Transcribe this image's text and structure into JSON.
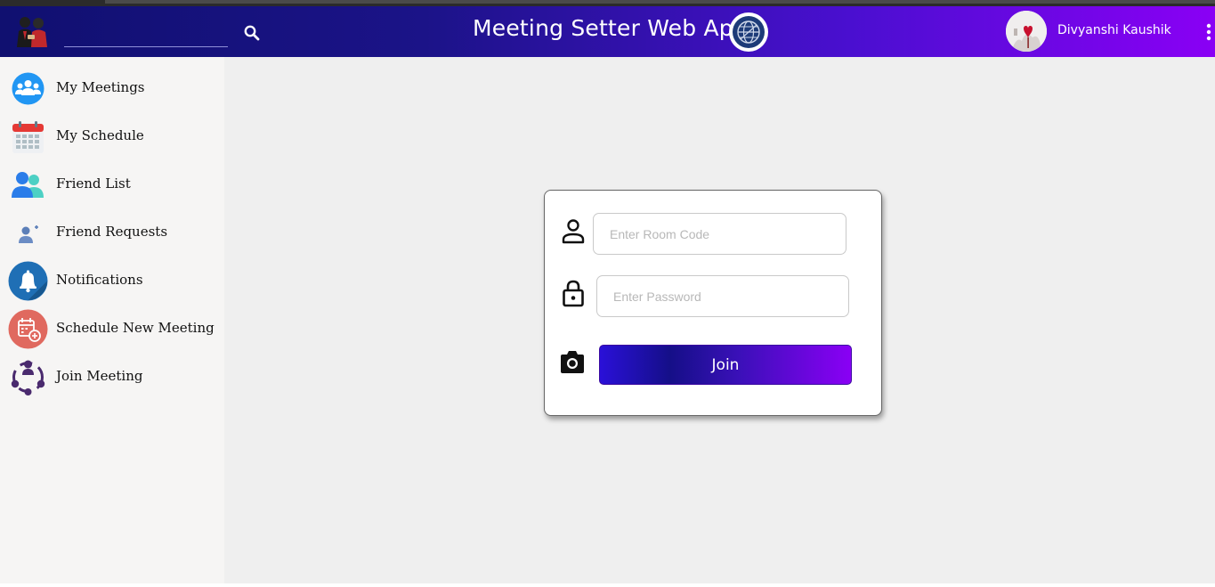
{
  "header": {
    "app_title": "Meeting Setter Web App",
    "search_placeholder": "",
    "user_name": "Divyanshi Kaushik"
  },
  "sidebar": {
    "items": [
      {
        "label": "My Meetings",
        "icon": "group-icon"
      },
      {
        "label": "My Schedule",
        "icon": "calendar-icon"
      },
      {
        "label": "Friend List",
        "icon": "friends-icon"
      },
      {
        "label": "Friend Requests",
        "icon": "add-friend-icon"
      },
      {
        "label": "Notifications",
        "icon": "bell-icon"
      },
      {
        "label": "Schedule New Meeting",
        "icon": "calendar-add-icon"
      },
      {
        "label": "Join Meeting",
        "icon": "people-circle-icon"
      }
    ]
  },
  "join_form": {
    "room_code_placeholder": "Enter Room Code",
    "password_placeholder": "Enter Password",
    "join_label": "Join"
  },
  "colors": {
    "header_gradient_start": "#101070",
    "header_gradient_end": "#8a00f5",
    "sidebar_bg": "#f6f5f4",
    "content_bg": "#efefef"
  }
}
